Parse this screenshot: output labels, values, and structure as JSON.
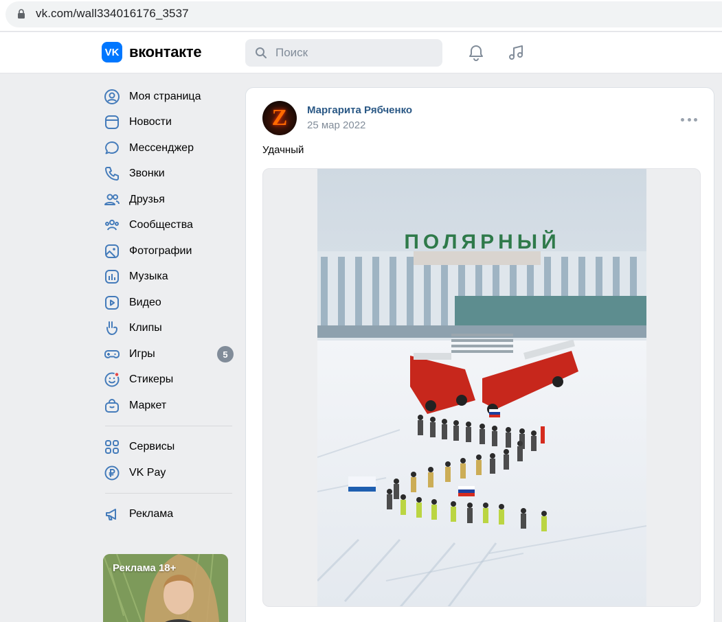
{
  "browser": {
    "url": "vk.com/wall334016176_3537"
  },
  "header": {
    "logo_text": "вконтакте",
    "logo_mark": "VK",
    "search_placeholder": "Поиск",
    "icons": [
      "bell-icon",
      "music-icon"
    ]
  },
  "sidebar": {
    "items": [
      {
        "label": "Моя страница",
        "icon": "user-circle-icon"
      },
      {
        "label": "Новости",
        "icon": "news-icon"
      },
      {
        "label": "Мессенджер",
        "icon": "message-icon"
      },
      {
        "label": "Звонки",
        "icon": "phone-icon"
      },
      {
        "label": "Друзья",
        "icon": "friends-icon"
      },
      {
        "label": "Сообщества",
        "icon": "communities-icon"
      },
      {
        "label": "Фотографии",
        "icon": "photo-icon"
      },
      {
        "label": "Музыка",
        "icon": "music-icon"
      },
      {
        "label": "Видео",
        "icon": "video-icon"
      },
      {
        "label": "Клипы",
        "icon": "clips-icon"
      },
      {
        "label": "Игры",
        "icon": "gamepad-icon",
        "badge": "5"
      },
      {
        "label": "Стикеры",
        "icon": "sticker-icon"
      },
      {
        "label": "Маркет",
        "icon": "market-icon"
      }
    ],
    "services": [
      {
        "label": "Сервисы",
        "icon": "services-icon"
      },
      {
        "label": "VK Pay",
        "icon": "vkpay-icon"
      }
    ],
    "ads": [
      {
        "label": "Реклама",
        "icon": "megaphone-icon"
      }
    ],
    "ad_banner": {
      "label": "Реклама 18+"
    }
  },
  "post": {
    "author": "Маргарита Рябченко",
    "avatar_letter": "Z",
    "date": "25 мар 2022",
    "text": "Удачный",
    "photo_sign": "ПОЛЯРНЫЙ"
  },
  "colors": {
    "accent": "#0077ff",
    "link": "#2a5885",
    "muted": "#818c99",
    "icon": "#447bba",
    "background": "#edeef0"
  }
}
